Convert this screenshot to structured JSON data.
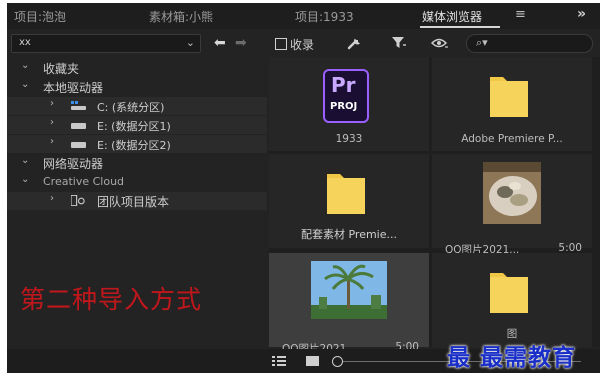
{
  "tabs": [
    {
      "label": "项目:泡泡",
      "active": false
    },
    {
      "label": "素材箱:小熊",
      "active": false
    },
    {
      "label": "项目:1933",
      "active": false
    },
    {
      "label": "媒体浏览器",
      "active": true
    }
  ],
  "tab_menu_icon": "hamburger-menu-icon",
  "tab_overflow_icon": "double-chevron-right-icon",
  "toolbar": {
    "path_value": "xx",
    "ingest_label": "收录"
  },
  "tree": {
    "favorites": "收藏夹",
    "local_drives": "本地驱动器",
    "drives": [
      {
        "label": "C: (系统分区)"
      },
      {
        "label": "E: (数据分区1)"
      },
      {
        "label": "E: (数据分区2)"
      }
    ],
    "network_drives": "网络驱动器",
    "creative_cloud": "Creative Cloud",
    "team_projects": "团队项目版本"
  },
  "grid": [
    {
      "name": "1933",
      "type": "premiere-project",
      "badge_top": "Pr",
      "badge_bottom": "PROJ"
    },
    {
      "name": "Adobe Premiere P...",
      "type": "folder"
    },
    {
      "name": "配套素材 Premie...",
      "type": "folder"
    },
    {
      "name": "QQ图片2021...",
      "duration": "5:00",
      "type": "image-food"
    },
    {
      "name": "QQ图片2021...",
      "duration": "5:00",
      "type": "image-palm",
      "selected": true
    },
    {
      "name": "图",
      "type": "folder"
    }
  ],
  "overlay_text": "第二种导入方式",
  "watermark": "最 最需教育",
  "colors": {
    "accent_purple": "#9a60ff",
    "folder_yellow": "#f0c845",
    "overlay_red": "#c0171c",
    "watermark_blue": "#1a2fc7"
  }
}
